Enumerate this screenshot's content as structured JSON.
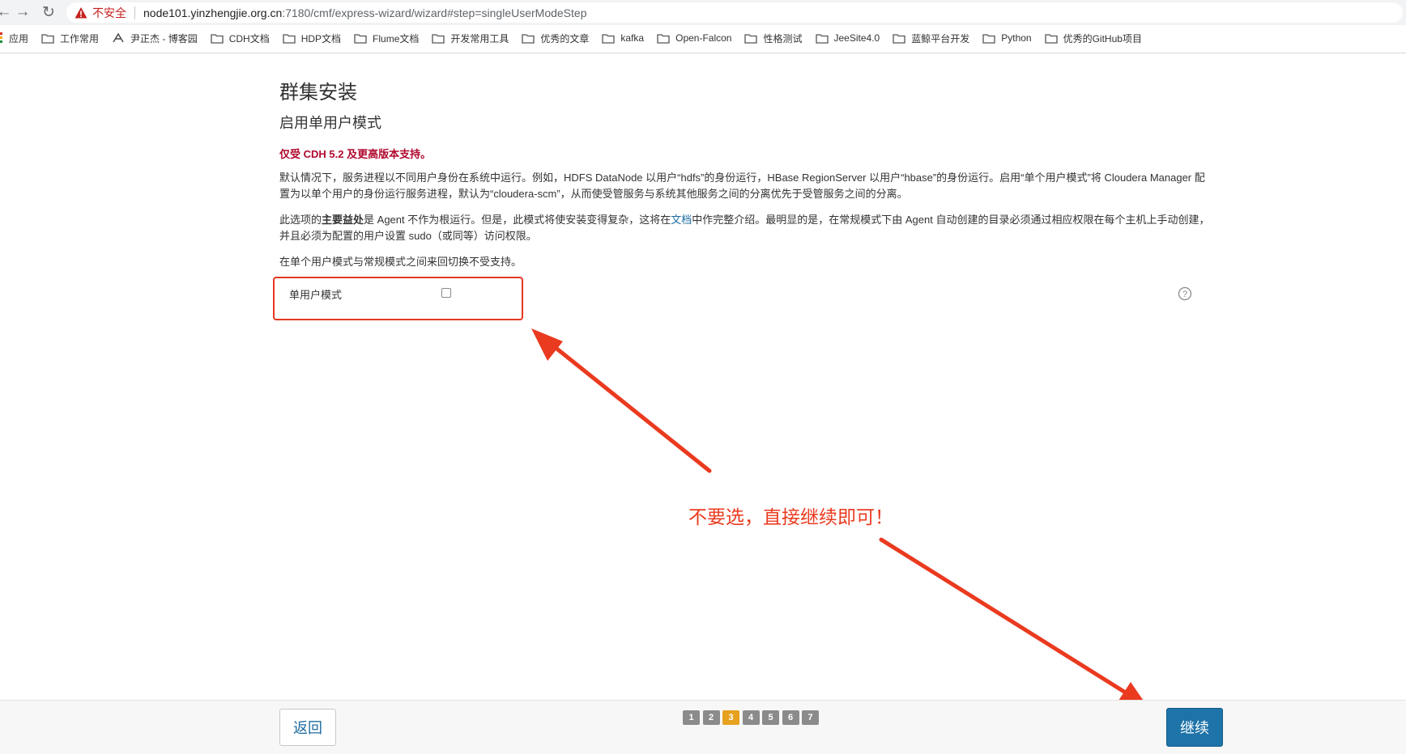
{
  "browser": {
    "insecure_label": "不安全",
    "url_host": "node101.yinzhengjie.org.cn",
    "url_rest": ":7180/cmf/express-wizard/wizard#step=singleUserModeStep"
  },
  "bookmarks": [
    {
      "label": "应用",
      "icon": "apps-icon"
    },
    {
      "label": "工作常用",
      "icon": "folder-icon"
    },
    {
      "label": "尹正杰 - 博客园",
      "icon": "site-icon"
    },
    {
      "label": "CDH文档",
      "icon": "folder-icon"
    },
    {
      "label": "HDP文档",
      "icon": "folder-icon"
    },
    {
      "label": "Flume文档",
      "icon": "folder-icon"
    },
    {
      "label": "开发常用工具",
      "icon": "folder-icon"
    },
    {
      "label": "优秀的文章",
      "icon": "folder-icon"
    },
    {
      "label": "kafka",
      "icon": "folder-icon"
    },
    {
      "label": "Open-Falcon",
      "icon": "folder-icon"
    },
    {
      "label": "性格测试",
      "icon": "folder-icon"
    },
    {
      "label": "JeeSite4.0",
      "icon": "folder-icon"
    },
    {
      "label": "蓝鲸平台开发",
      "icon": "folder-icon"
    },
    {
      "label": "Python",
      "icon": "folder-icon"
    },
    {
      "label": "优秀的GitHub项目",
      "icon": "folder-icon"
    }
  ],
  "page": {
    "title": "群集安装",
    "subtitle": "启用单用户模式",
    "notice": "仅受 CDH 5.2 及更高版本支持。",
    "para1": "默认情况下，服务进程以不同用户身份在系统中运行。例如，HDFS DataNode 以用户“hdfs”的身份运行，HBase RegionServer 以用户“hbase”的身份运行。启用“单个用户模式”将 Cloudera Manager 配置为以单个用户的身份运行服务进程，默认为“cloudera-scm”，从而使受管服务与系统其他服务之间的分离优先于受管服务之间的分离。",
    "para2_a": "此选项的",
    "para2_bold": "主要益处",
    "para2_b": "是 Agent 不作为根运行。但是，此模式将使安装变得复杂，这将在",
    "para2_link": "文档",
    "para2_c": "中作完整介绍。最明显的是，在常规模式下由 Agent 自动创建的目录必须通过相应权限在每个主机上手动创建，并且必须为配置的用户设置 sudo（或同等）访问权限。",
    "para3": "在单个用户模式与常规模式之间来回切换不受支持。",
    "field_label": "单用户模式",
    "checkbox_checked": false
  },
  "annotation": {
    "text": "不要选，直接继续即可！",
    "color": "#ea3a1f"
  },
  "footer": {
    "back_label": "返回",
    "continue_label": "继续",
    "steps": [
      "1",
      "2",
      "3",
      "4",
      "5",
      "6",
      "7"
    ],
    "current_step": 3
  },
  "colors": {
    "notice": "#b0092e",
    "link": "#1c6ca0",
    "primary_button": "#1e73a8",
    "active_step": "#e6a11f",
    "inactive_step": "#8b8b8b",
    "highlight_box": "#e53822"
  }
}
